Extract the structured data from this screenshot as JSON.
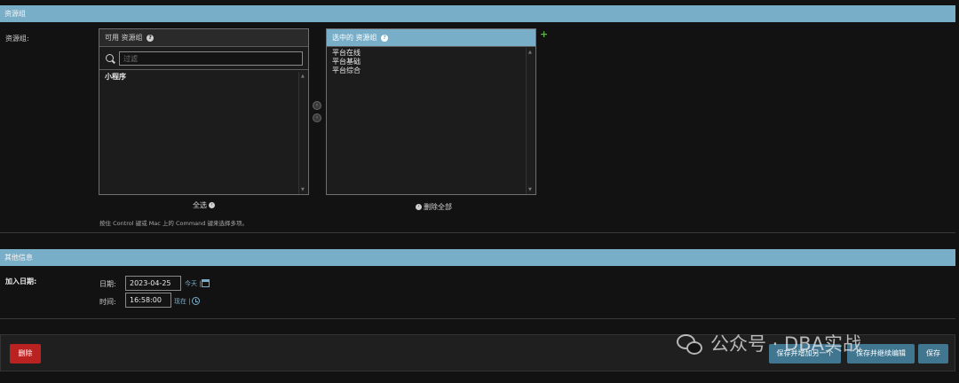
{
  "resource_section": {
    "header": "资源组",
    "field_label": "资源组:",
    "available": {
      "title": "可用 资源组",
      "help": "?",
      "filter_placeholder": "过滤",
      "options": [
        "小程序"
      ]
    },
    "chosen": {
      "title": "选中的 资源组",
      "help": "?",
      "options": [
        "平台在线",
        "平台基础",
        "平台综合"
      ]
    },
    "add_icon": "+",
    "arrow_right": "›",
    "arrow_left": "‹",
    "choose_all": "全选",
    "remove_all": "删除全部",
    "hint": "按住 Control 键或 Mac 上的 Command 键来选择多项。"
  },
  "other_section": {
    "header": "其他信息",
    "field_label": "加入日期:",
    "date_label": "日期:",
    "date_value": "2023-04-25",
    "today_link": "今天",
    "time_label": "时间:",
    "time_value": "16:58:00",
    "now_link": "现在"
  },
  "submit_row": {
    "delete_label": "删除",
    "save_add_label": "保存并增加另一个",
    "save_continue_label": "保存并继续编辑",
    "save_label": "保存"
  },
  "watermark": "公众号 · DBA实战",
  "colors": {
    "header": "#79aec8",
    "danger": "#ba2121",
    "primary": "#417690",
    "link": "#79aec8",
    "add": "#5fb548"
  }
}
